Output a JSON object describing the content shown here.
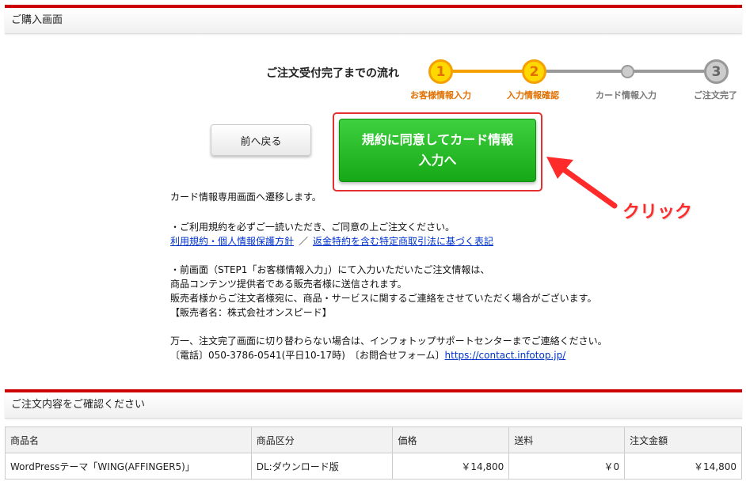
{
  "header1": {
    "title": "ご購入画面"
  },
  "flow": {
    "title": "ご注文受付完了までの流れ",
    "steps": [
      {
        "number": "1",
        "label": "お客様情報入力",
        "state": "done"
      },
      {
        "number": "2",
        "label": "入力情報確認",
        "state": "current"
      },
      {
        "number": "",
        "label": "カード情報入力",
        "state": "pending"
      },
      {
        "number": "3",
        "label": "ご注文完了",
        "state": "pending"
      }
    ]
  },
  "buttons": {
    "back": "前へ戻る",
    "agree_line1": "規約に同意してカード情報",
    "agree_line2": "入力へ"
  },
  "annotation": {
    "click": "クリック"
  },
  "info": {
    "p1": "カード情報専用画面へ遷移します。",
    "p2": "・ご利用規約を必ずご一読いただき、ご同意の上ご注文ください。",
    "link_terms": "利用規約・個人情報保護方針",
    "link_sep": "／",
    "link_refund": "返金特約を含む特定商取引法に基づく表記",
    "p3_1": "・前画面（STEP1「お客様情報入力」）にて入力いただいたご注文情報は、",
    "p3_2": "商品コンテンツ提供者である販売者様に送信されます。",
    "p3_3": "販売者様からご注文者様宛に、商品・サービスに関するご連絡をさせていただく場合がございます。",
    "p3_4": "【販売者名：株式会社オンスピード】",
    "p4_1": "万一、注文完了画面に切り替わらない場合は、インフォトップサポートセンターまでご連絡ください。",
    "p4_2_prefix": "〔電話〕050-3786-0541(平日10-17時)　〔お問合せフォーム〕",
    "link_contact": "https://contact.infotop.jp/"
  },
  "header2": {
    "title": "ご注文内容をご確認ください"
  },
  "table": {
    "columns": [
      "商品名",
      "商品区分",
      "価格",
      "送料",
      "注文金額"
    ],
    "rows": [
      [
        "WordPressテーマ「WING(AFFINGER5)」",
        "DL:ダウンロード版",
        "￥14,800",
        "￥0",
        "￥14,800"
      ]
    ]
  },
  "colors": {
    "accent_red": "#cc0000",
    "step_active": "#f5a000",
    "button_green": "#16a816",
    "annotation_red": "#ff2a2a",
    "link_blue": "#0033cc"
  }
}
